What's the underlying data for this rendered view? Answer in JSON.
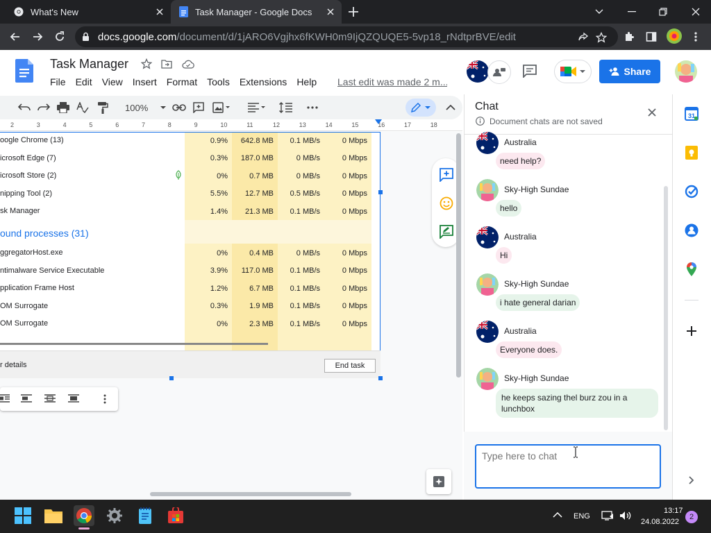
{
  "browser": {
    "tabs": [
      {
        "title": "What's New"
      },
      {
        "title": "Task Manager - Google Docs"
      }
    ],
    "url": {
      "host": "docs.google.com",
      "path": "/document/d/1jARO6Vgjhx6fKWH0m9IjQZQUQE5-5vp18_rNdtprBVE/edit"
    }
  },
  "docs": {
    "title": "Task Manager",
    "menu": [
      "File",
      "Edit",
      "View",
      "Insert",
      "Format",
      "Tools",
      "Extensions",
      "Help"
    ],
    "last_edit": "Last edit was made 2 m...",
    "share_label": "Share",
    "zoom": "100%",
    "ruler_ticks": [
      "2",
      "3",
      "4",
      "5",
      "6",
      "7",
      "8",
      "9",
      "10",
      "11",
      "12",
      "13",
      "14",
      "15",
      "16",
      "17",
      "18"
    ]
  },
  "task_manager": {
    "apps": [
      {
        "name": "oogle Chrome (13)",
        "cpu": "0.9%",
        "memory": "642.8 MB",
        "disk": "0.1 MB/s",
        "network": "0 Mbps"
      },
      {
        "name": "icrosoft Edge (7)",
        "cpu": "0.3%",
        "memory": "187.0 MB",
        "disk": "0 MB/s",
        "network": "0 Mbps"
      },
      {
        "name": "icrosoft Store (2)",
        "cpu": "0%",
        "memory": "0.7 MB",
        "disk": "0 MB/s",
        "network": "0 Mbps"
      },
      {
        "name": "nipping Tool (2)",
        "cpu": "5.5%",
        "memory": "12.7 MB",
        "disk": "0.5 MB/s",
        "network": "0 Mbps"
      },
      {
        "name": "sk Manager",
        "cpu": "1.4%",
        "memory": "21.3 MB",
        "disk": "0.1 MB/s",
        "network": "0 Mbps"
      }
    ],
    "background_header": "ound processes (31)",
    "background": [
      {
        "name": "ggregatorHost.exe",
        "cpu": "0%",
        "memory": "0.4 MB",
        "disk": "0 MB/s",
        "network": "0 Mbps"
      },
      {
        "name": "ntimalware Service Executable",
        "cpu": "3.9%",
        "memory": "117.0 MB",
        "disk": "0.1 MB/s",
        "network": "0 Mbps"
      },
      {
        "name": "pplication Frame Host",
        "cpu": "1.2%",
        "memory": "6.7 MB",
        "disk": "0.1 MB/s",
        "network": "0 Mbps"
      },
      {
        "name": "OM Surrogate",
        "cpu": "0.3%",
        "memory": "1.9 MB",
        "disk": "0.1 MB/s",
        "network": "0 Mbps"
      },
      {
        "name": "OM Surrogate",
        "cpu": "0%",
        "memory": "2.3 MB",
        "disk": "0.1 MB/s",
        "network": "0 Mbps"
      }
    ],
    "more_details": "r details",
    "end_task": "End task"
  },
  "chat": {
    "title": "Chat",
    "note": "Document chats are not saved",
    "messages": [
      {
        "user": "Australia",
        "text": "need help?"
      },
      {
        "user": "Sky-High Sundae",
        "text": "hello"
      },
      {
        "user": "Australia",
        "text": "Hi"
      },
      {
        "user": "Sky-High Sundae",
        "text": "i hate general darian"
      },
      {
        "user": "Australia",
        "text": "Everyone does."
      },
      {
        "user": "Sky-High Sundae",
        "text": "he keeps sazing thel burz zou in a",
        "text2": "lunchbox"
      }
    ],
    "input_placeholder": "Type here to chat"
  },
  "taskbar": {
    "lang": "ENG",
    "time": "13:17",
    "date": "24.08.2022",
    "notifications": "2"
  },
  "colors": {
    "accent": "#1a73e8",
    "australia_bubble": "#fce8ef",
    "sky_bubble": "#e6f4ea",
    "cpu_highlight": "#fbe9a8"
  }
}
